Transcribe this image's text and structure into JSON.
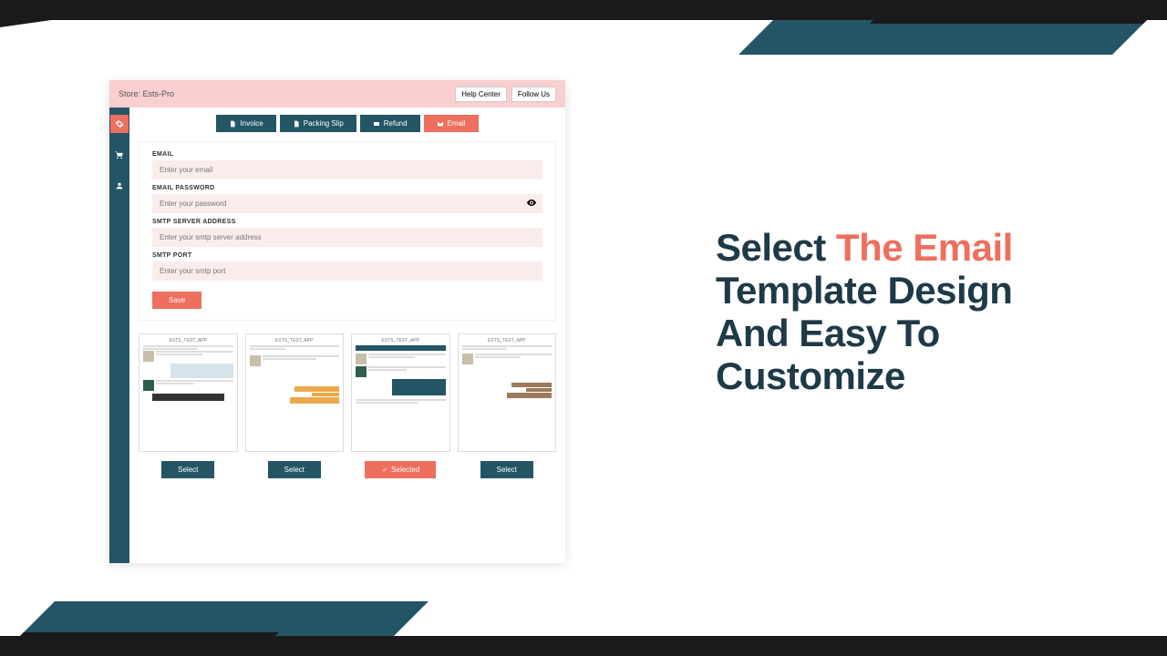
{
  "decor": {},
  "app": {
    "store_label": "Store: Ests-Pro",
    "help_center": "Help Center",
    "follow_us": "Follow Us",
    "tabs": {
      "invoice": "Invoice",
      "packing": "Packing Slip",
      "refund": "Refund",
      "email": "Email"
    },
    "form": {
      "email_label": "EMAIL",
      "email_ph": "Enter your email",
      "pw_label": "EMAIL PASSWORD",
      "pw_ph": "Enter your password",
      "smtp_label": "SMTP SERVER ADDRESS",
      "smtp_ph": "Enter your smtp server address",
      "port_label": "SMTP PORT",
      "port_ph": "Enter your smtp port",
      "save": "Save"
    },
    "templates": {
      "t1_head": "ESTS_TEST_APP",
      "t2_head": "ESTS_TEST_APP",
      "t3_head": "ESTS_TEST_APP",
      "t4_head": "ESTS_TEST_APP",
      "select": "Select",
      "selected": "Selected"
    }
  },
  "hero": {
    "p1": "Select ",
    "p2": "The Email",
    "p3": " Template Design And Easy To Customize"
  }
}
